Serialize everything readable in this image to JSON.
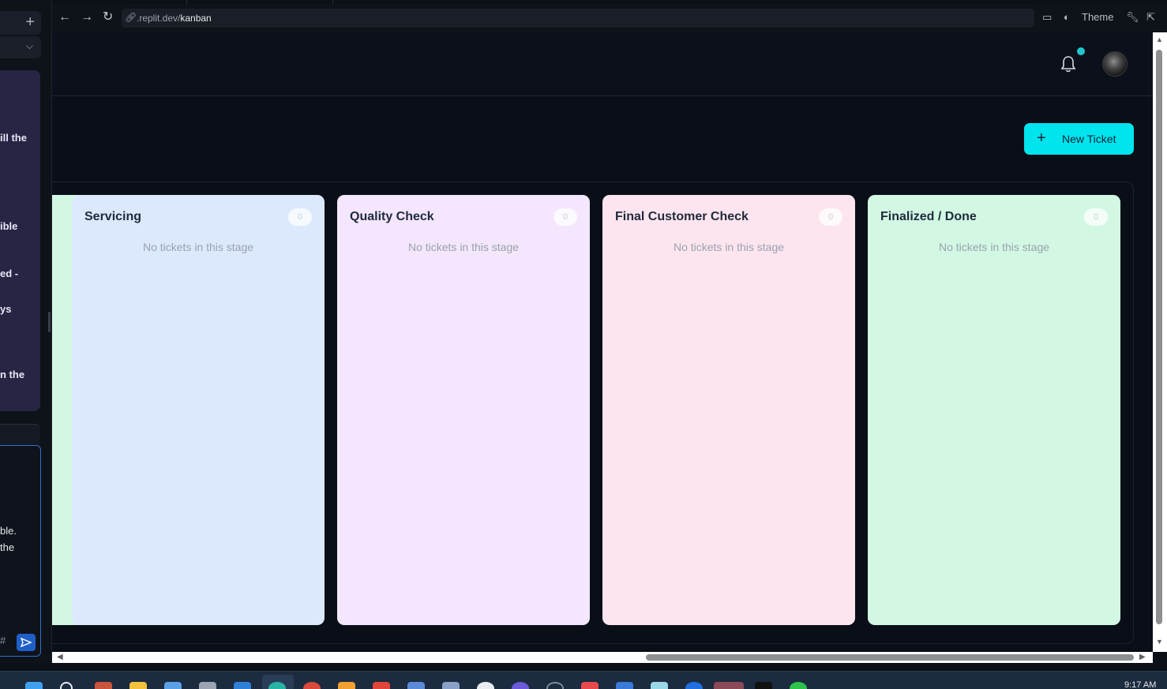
{
  "left_panel": {
    "message_fragments": [
      "ill the",
      "ible",
      "ed -",
      "ys",
      "n the"
    ],
    "input_fragments": [
      "ble.",
      "the"
    ],
    "hash_symbol": "#",
    "send_icon": "send-icon"
  },
  "browser": {
    "url_prefix": ".replit.dev/",
    "url_path": "kanban",
    "theme_label": "Theme"
  },
  "app": {
    "new_ticket_label": "New Ticket",
    "columns": [
      {
        "title": "Servicing",
        "count": "0",
        "empty_text": "No tickets in this stage",
        "color": "#dce9fd"
      },
      {
        "title": "Quality Check",
        "count": "0",
        "empty_text": "No tickets in this stage",
        "color": "#f3e6fd"
      },
      {
        "title": "Final Customer Check",
        "count": "0",
        "empty_text": "No tickets in this stage",
        "color": "#fce5ef"
      },
      {
        "title": "Finalized / Done",
        "count": "0",
        "empty_text": "No tickets in this stage",
        "color": "#d2f8e4"
      }
    ],
    "partial_column_color": "#d2f8e4",
    "accent_color": "#00e4ee",
    "notification_dot_color": "#20c6cf"
  },
  "taskbar": {
    "clock": "9:17 AM"
  }
}
